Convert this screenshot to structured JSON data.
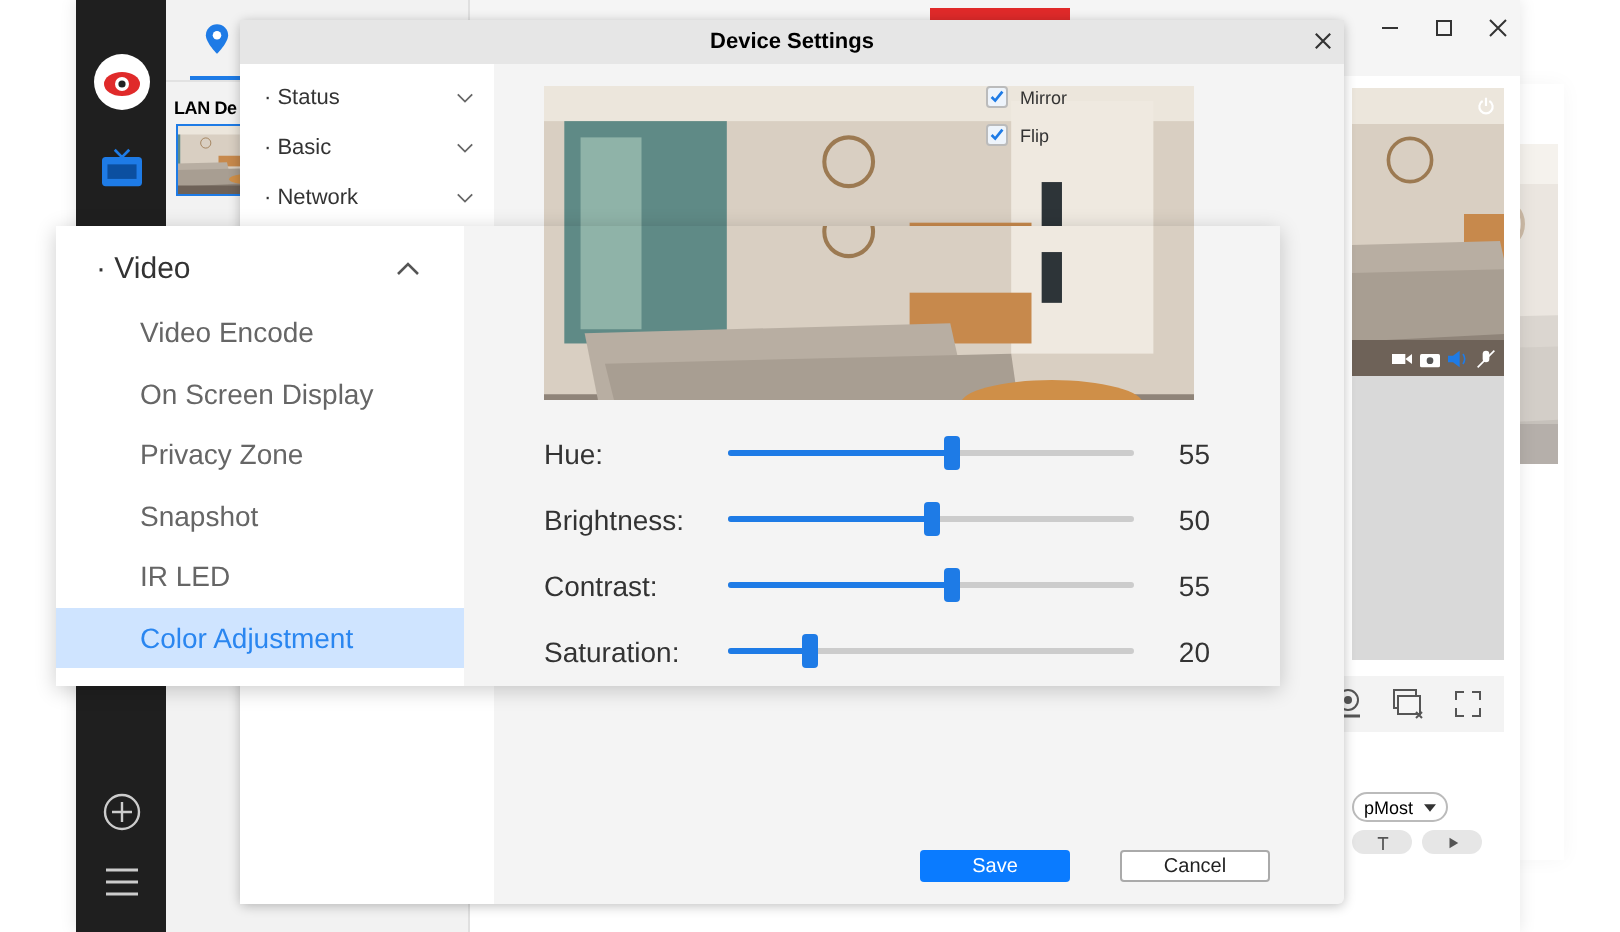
{
  "app": {
    "section_title": "LAN De",
    "view_dropdown": {
      "value": "pMost"
    }
  },
  "dialog": {
    "title": "Device Settings",
    "menu": [
      {
        "label": "· Status",
        "expanded": false
      },
      {
        "label": "· Basic",
        "expanded": false
      },
      {
        "label": "· Network",
        "expanded": false
      }
    ],
    "checkboxes": [
      {
        "label": "Mirror",
        "checked": true
      },
      {
        "label": "Flip",
        "checked": true
      }
    ],
    "buttons": [
      {
        "label": "Save",
        "kind": "primary"
      },
      {
        "label": "Cancel",
        "kind": "secondary"
      }
    ]
  },
  "zoom_panel": {
    "group": {
      "label": "· Video",
      "expanded": true
    },
    "items": [
      {
        "label": "Video Encode",
        "selected": false
      },
      {
        "label": "On Screen Display",
        "selected": false
      },
      {
        "label": "Privacy Zone",
        "selected": false
      },
      {
        "label": "Snapshot",
        "selected": false
      },
      {
        "label": "IR LED",
        "selected": false
      },
      {
        "label": "Color Adjustment",
        "selected": true
      }
    ],
    "sliders": [
      {
        "label": "Hue:",
        "level": 0.55,
        "reading": "55"
      },
      {
        "label": "Brightness:",
        "level": 0.5,
        "reading": "50"
      },
      {
        "label": "Contrast:",
        "level": 0.55,
        "reading": "55"
      },
      {
        "label": "Saturation:",
        "level": 0.2,
        "reading": "20"
      }
    ]
  }
}
